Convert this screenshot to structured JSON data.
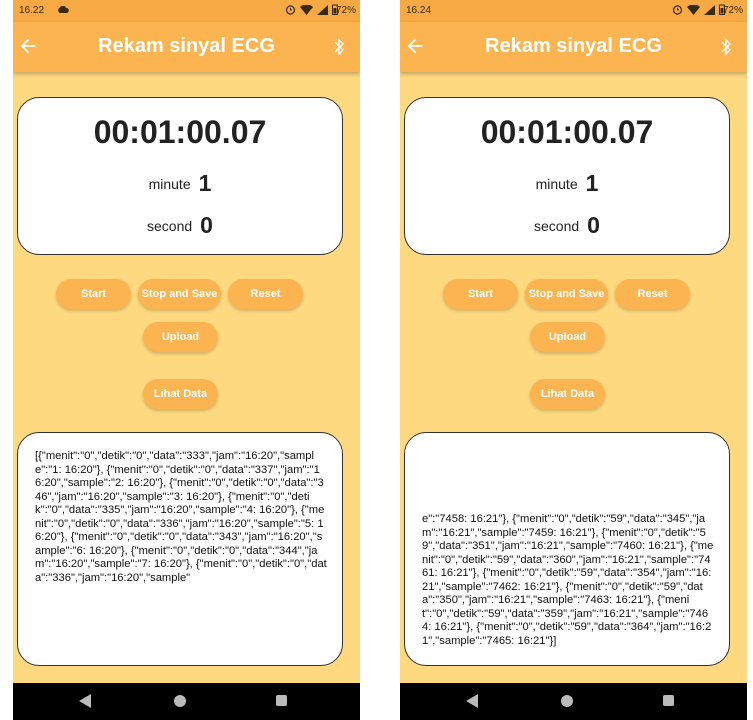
{
  "screens": [
    {
      "status": {
        "time": "16.22",
        "battery": "72%"
      },
      "app_bar": {
        "title": "Rekam sinyal ECG"
      },
      "timer": {
        "display": "00:01:00.07",
        "minute_label": "minute",
        "minute_value": "1",
        "second_label": "second",
        "second_value": "0"
      },
      "buttons": {
        "start": "Start",
        "stop_save": "Stop and Save",
        "reset": "Reset",
        "upload": "Upload",
        "lihat_data": "Lihat Data"
      },
      "data_text": "[{\"menit\":\"0\",\"detik\":\"0\",\"data\":\"333\",\"jam\":\"16:20\",\"sample\":\"1: 16:20\"}, {\"menit\":\"0\",\"detik\":\"0\",\"data\":\"337\",\"jam\":\"16:20\",\"sample\":\"2: 16:20\"}, {\"menit\":\"0\",\"detik\":\"0\",\"data\":\"346\",\"jam\":\"16:20\",\"sample\":\"3: 16:20\"}, {\"menit\":\"0\",\"detik\":\"0\",\"data\":\"335\",\"jam\":\"16:20\",\"sample\":\"4: 16:20\"}, {\"menit\":\"0\",\"detik\":\"0\",\"data\":\"336\",\"jam\":\"16:20\",\"sample\":\"5: 16:20\"}, {\"menit\":\"0\",\"detik\":\"0\",\"data\":\"343\",\"jam\":\"16:20\",\"sample\":\"6: 16:20\"}, {\"menit\":\"0\",\"detik\":\"0\",\"data\":\"344\",\"jam\":\"16:20\",\"sample\":\"7: 16:20\"}, {\"menit\":\"0\",\"detik\":\"0\",\"data\":\"336\",\"jam\":\"16:20\",\"sample\""
    },
    {
      "status": {
        "time": "16.24",
        "battery": "72%"
      },
      "app_bar": {
        "title": "Rekam sinyal ECG"
      },
      "timer": {
        "display": "00:01:00.07",
        "minute_label": "minute",
        "minute_value": "1",
        "second_label": "second",
        "second_value": "0"
      },
      "buttons": {
        "start": "Start",
        "stop_save": "Stop and Save",
        "reset": "Reset",
        "upload": "Upload",
        "lihat_data": "Lihat Data"
      },
      "data_text": "e\":\"7458: 16:21\"}, {\"menit\":\"0\",\"detik\":\"59\",\"data\":\"345\",\"jam\":\"16:21\",\"sample\":\"7459: 16:21\"}, {\"menit\":\"0\",\"detik\":\"59\",\"data\":\"351\",\"jam\":\"16:21\",\"sample\":\"7460: 16:21\"}, {\"menit\":\"0\",\"detik\":\"59\",\"data\":\"360\",\"jam\":\"16:21\",\"sample\":\"7461: 16:21\"}, {\"menit\":\"0\",\"detik\":\"59\",\"data\":\"354\",\"jam\":\"16:21\",\"sample\":\"7462: 16:21\"}, {\"menit\":\"0\",\"detik\":\"59\",\"data\":\"350\",\"jam\":\"16:21\",\"sample\":\"7463: 16:21\"}, {\"menit\":\"0\",\"detik\":\"59\",\"data\":\"359\",\"jam\":\"16:21\",\"sample\":\"7464: 16:21\"}, {\"menit\":\"0\",\"detik\":\"59\",\"data\":\"364\",\"jam\":\"16:21\",\"sample\":\"7465: 16:21\"}]"
    }
  ],
  "colors": {
    "app_bar": "#fbb44f",
    "status_bar": "#f7a944",
    "background": "#ffd97f",
    "button": "#fbb44f",
    "card": "#ffffff"
  },
  "icons": [
    "back-arrow-icon",
    "bluetooth-icon",
    "cloud-icon",
    "alarm-icon",
    "wifi-icon",
    "signal-icon",
    "battery-icon",
    "nav-back-icon",
    "nav-home-icon",
    "nav-recent-icon"
  ]
}
